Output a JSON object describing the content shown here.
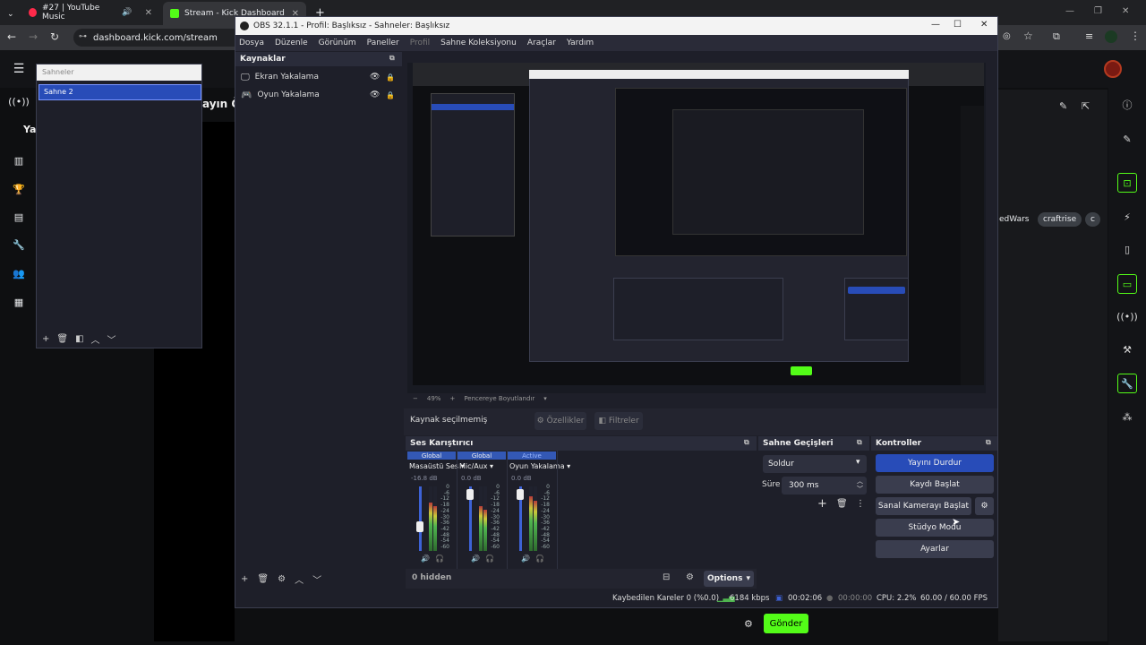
{
  "browser": {
    "tabs": [
      {
        "label": "#27 | YouTube Music",
        "color": "#ff2a4a"
      },
      {
        "label": "Stream - Kick Dashboard",
        "color": "#53fc18"
      }
    ],
    "url": "dashboard.kick.com/stream"
  },
  "kick": {
    "heading_partial": "ayın Ön",
    "side_label": "Ya",
    "chips": [
      "edWars",
      "craftrise",
      "c"
    ],
    "send_label": "Gönder"
  },
  "sahneler_panel": {
    "title": "Sahneler",
    "items": [
      "Sahne 2"
    ]
  },
  "obs": {
    "title": "OBS 32.1.1 - Profil: Başlıksız - Sahneler: Başlıksız",
    "menu": [
      "Dosya",
      "Düzenle",
      "Görünüm",
      "Paneller",
      "Profil",
      "Sahne Koleksiyonu",
      "Araçlar",
      "Yardım"
    ],
    "sources": {
      "title": "Kaynaklar",
      "items": [
        "Ekran Yakalama",
        "Oyun Yakalama"
      ]
    },
    "preview": {
      "zoom": "49%",
      "fit_label": "Pencereye Boyutlandır"
    },
    "source_bar": {
      "none_label": "Kaynak seçilmemiş",
      "properties": "Özellikler",
      "filters": "Filtreler"
    },
    "mixer": {
      "title": "Ses Karıştırıcı",
      "channels": [
        {
          "header": "Global",
          "name": "Masaüstü Ses",
          "db": "-16.8 dB",
          "level": 0.75,
          "fader": 0.35
        },
        {
          "header": "Global",
          "name": "Mic/Aux",
          "db": "0.0 dB",
          "level": 0.7,
          "fader": 0.95
        },
        {
          "header": "Active",
          "name": "Oyun Yakalama",
          "db": "0.0 dB",
          "level": 0.85,
          "fader": 0.95
        }
      ],
      "scale": [
        "0",
        "-6",
        "-12",
        "-18",
        "-24",
        "-30",
        "-36",
        "-42",
        "-48",
        "-54",
        "-60"
      ],
      "hidden": "0 hidden",
      "options": "Options"
    },
    "transitions": {
      "title": "Sahne Geçişleri",
      "selected": "Soldur",
      "duration_label": "Süre",
      "duration": "300 ms"
    },
    "controls": {
      "title": "Kontroller",
      "stop_stream": "Yayını Durdur",
      "start_record": "Kaydı Başlat",
      "virtual_cam": "Sanal Kamerayı Başlat",
      "studio_mode": "Stüdyo Modu",
      "settings": "Ayarlar"
    },
    "status": {
      "dropped": "Kaybedilen Kareler 0 (%0.0)",
      "bitrate": "6184 kbps",
      "stream_time": "00:02:06",
      "record_time": "00:00:00",
      "cpu": "CPU: 2.2%",
      "fps": "60.00 / 60.00 FPS"
    }
  }
}
